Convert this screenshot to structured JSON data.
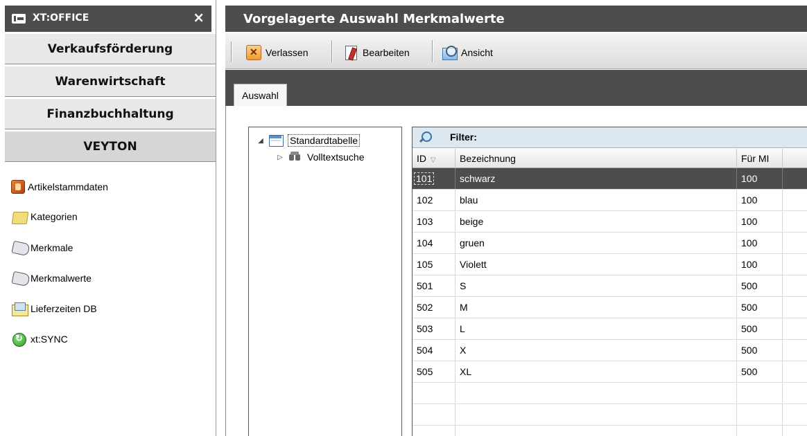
{
  "sidebar": {
    "app_title": "XT:OFFICE",
    "close_label": "×",
    "sections": [
      "Verkaufsförderung",
      "Warenwirtschaft",
      "Finanzbuchhaltung",
      "VEYTON"
    ],
    "active_section": "VEYTON",
    "items": [
      {
        "label": "Artikelstammdaten",
        "icon": "product-box-icon"
      },
      {
        "label": "Kategorien",
        "icon": "folder-icon"
      },
      {
        "label": "Merkmale",
        "icon": "tag-icon"
      },
      {
        "label": "Merkmalwerte",
        "icon": "tag-icon"
      },
      {
        "label": "Lieferzeiten DB",
        "icon": "envelope-icon"
      },
      {
        "label": "xt:SYNC",
        "icon": "sync-icon"
      }
    ]
  },
  "window": {
    "title": "Vorgelagerte Auswahl Merkmalwerte"
  },
  "toolbar": {
    "verlassen_label": "Verlassen",
    "bearbeiten_label": "Bearbeiten",
    "ansicht_label": "Ansicht"
  },
  "tabs": {
    "active_label": "Auswahl"
  },
  "tree": {
    "root_label": "Standardtabelle",
    "child_label": "Volltextsuche"
  },
  "grid": {
    "filter_label": "Filter:",
    "columns": {
      "id": "ID",
      "bezeichnung": "Bezeichnung",
      "fuer": "Für MI"
    },
    "rows": [
      {
        "id": "101",
        "bezeichnung": "schwarz",
        "fuer": "100",
        "selected": true
      },
      {
        "id": "102",
        "bezeichnung": "blau",
        "fuer": "100"
      },
      {
        "id": "103",
        "bezeichnung": "beige",
        "fuer": "100"
      },
      {
        "id": "104",
        "bezeichnung": "gruen",
        "fuer": "100"
      },
      {
        "id": "105",
        "bezeichnung": "Violett",
        "fuer": "100"
      },
      {
        "id": "501",
        "bezeichnung": "S",
        "fuer": "500"
      },
      {
        "id": "502",
        "bezeichnung": "M",
        "fuer": "500"
      },
      {
        "id": "503",
        "bezeichnung": "L",
        "fuer": "500"
      },
      {
        "id": "504",
        "bezeichnung": "X",
        "fuer": "500"
      },
      {
        "id": "505",
        "bezeichnung": "XL",
        "fuer": "500"
      }
    ]
  },
  "colors": {
    "header_bg": "#4d4d4d",
    "selected_row_bg": "#4d4d4d",
    "filter_bar_bg": "#dde7f0"
  }
}
